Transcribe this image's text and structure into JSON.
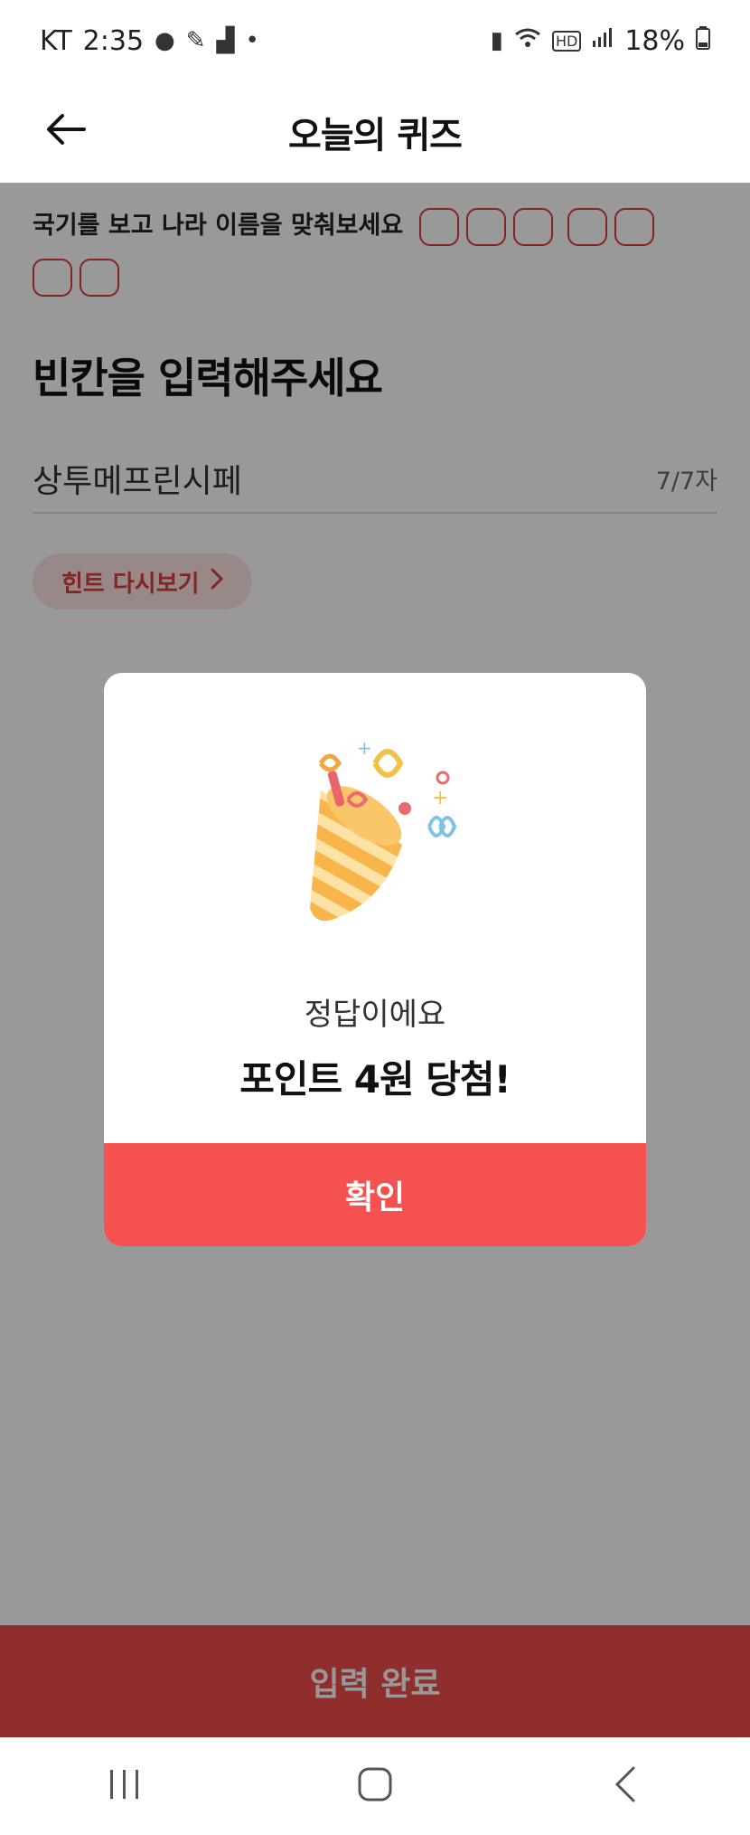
{
  "status_bar": {
    "carrier": "KT",
    "time": "2:35",
    "battery": "18%",
    "icons": [
      "notification-icon",
      "pen-icon",
      "stairs-icon",
      "dot-icon",
      "battery-saver-icon",
      "wifi-icon",
      "hd-icon",
      "signal-icon",
      "battery-icon"
    ]
  },
  "header": {
    "title": "오늘의 퀴즈",
    "back_icon": "back-arrow-icon"
  },
  "quiz": {
    "question": "국기를 보고 나라 이름을 맞춰보세요",
    "box_count": 7,
    "fill_title": "빈칸을 입력해주세요",
    "answer_value": "상투메프린시페",
    "char_count": "7/7자",
    "hint_label": "힌트 다시보기"
  },
  "bottom": {
    "cta_label": "입력 완료"
  },
  "modal": {
    "subtitle": "정답이에요",
    "title": "포인트 4원 당첨!",
    "confirm_label": "확인",
    "illustration": "party-popper-icon"
  },
  "nav": {
    "icons": [
      "recent-apps-icon",
      "home-icon",
      "back-icon"
    ]
  },
  "colors": {
    "accent": "#f55151",
    "box_border": "#e03b3b",
    "hint_bg": "#fde3e3",
    "hint_text": "#d8403c",
    "overlay": "rgba(0,0,0,0.40)"
  }
}
